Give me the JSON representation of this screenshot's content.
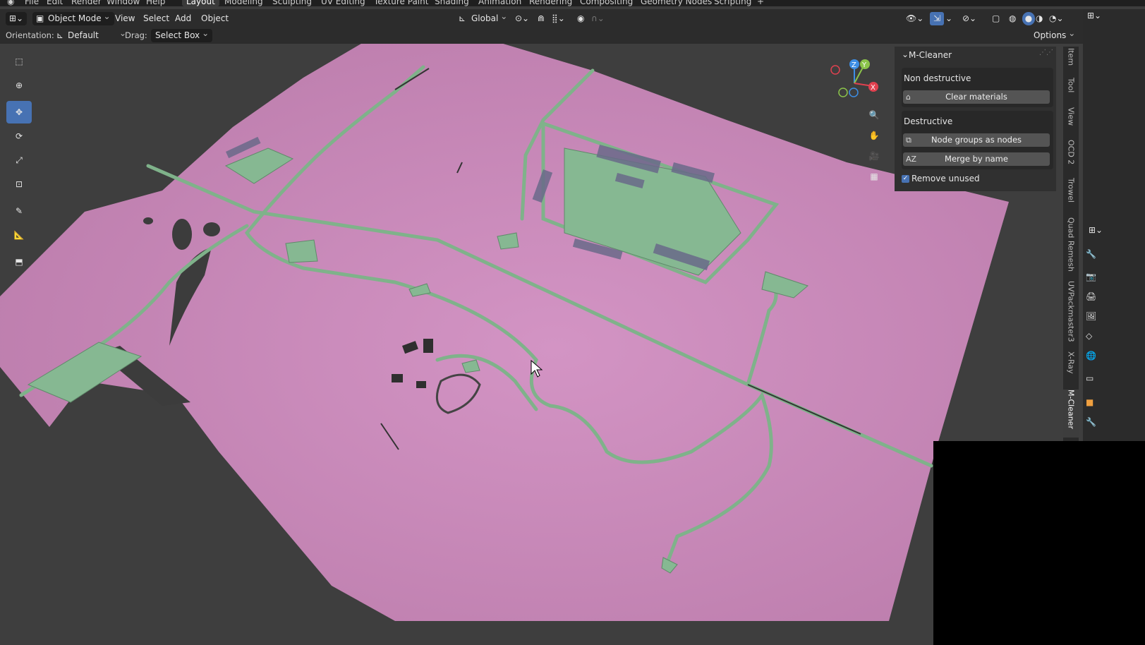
{
  "topbar": {
    "menus": [
      "File",
      "Edit",
      "Render",
      "Window",
      "Help"
    ],
    "workspaces": [
      "Layout",
      "Modeling",
      "Sculpting",
      "UV Editing",
      "Texture Paint",
      "Shading",
      "Animation",
      "Rendering",
      "Compositing",
      "Geometry Nodes",
      "Scripting"
    ],
    "add_tab": "+"
  },
  "header": {
    "mode": "Object Mode",
    "menus": [
      "View",
      "Select",
      "Add",
      "Object"
    ],
    "transform_orientation": "Global"
  },
  "tool_settings": {
    "orientation_label": "Orientation:",
    "orientation_value": "Default",
    "drag_label": "Drag:",
    "drag_value": "Select Box",
    "options": "Options"
  },
  "gizmo": {
    "z": "Z",
    "y": "Y",
    "x": "X"
  },
  "npanel": {
    "title": "M-Cleaner",
    "non_destructive_label": "Non destructive",
    "clear_materials": "Clear materials",
    "destructive_label": "Destructive",
    "node_groups": "Node groups as nodes",
    "merge_by_name": "Merge by name",
    "merge_icon": "AZ",
    "remove_unused": "Remove unused",
    "remove_unused_checked": true
  },
  "sidebar_tabs": [
    "Item",
    "Tool",
    "View",
    "OCD 2",
    "Trowel",
    "Quad Remesh",
    "UVPackmaster3",
    "X-Ray",
    "M-Cleaner"
  ],
  "active_sidebar_tab": "M-Cleaner",
  "colors": {
    "terrain": "#c98abb",
    "roads": "#7fb28a",
    "viewport_bg": "#3e3e3e",
    "accent": "#4772b3",
    "axis_x": "#e0414f",
    "axis_y": "#8bc34a",
    "axis_z": "#3d8ee5"
  }
}
